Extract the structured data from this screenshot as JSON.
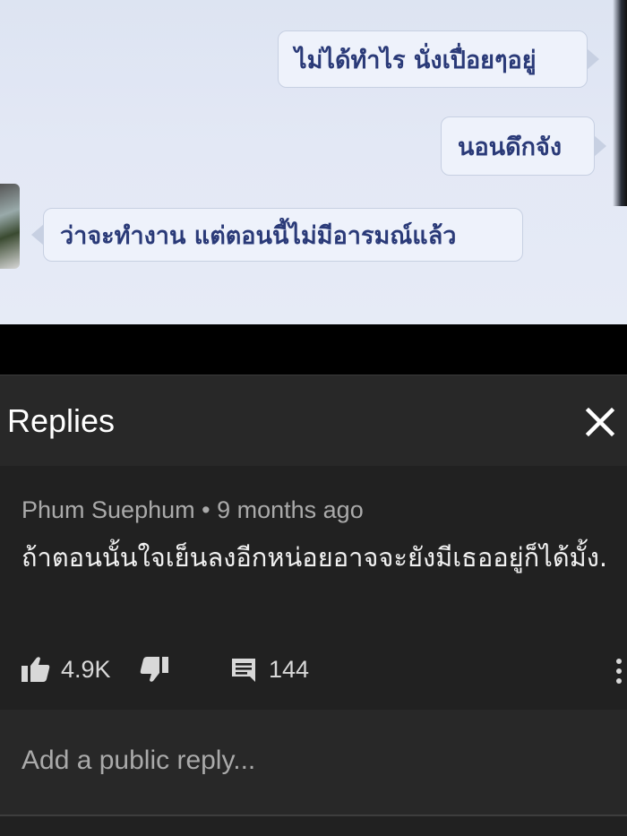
{
  "video": {
    "messages": [
      {
        "side": "right",
        "text": "ไม่ได้ทำไร นั่งเปื่อยๆอยู่"
      },
      {
        "side": "right",
        "text": "นอนดึกจัง"
      },
      {
        "side": "left",
        "text": "ว่าจะทำงาน แต่ตอนนี้ไม่มีอารมณ์แล้ว"
      }
    ]
  },
  "panel": {
    "title": "Replies",
    "close_icon": "close-icon"
  },
  "comment": {
    "author": "Phum Suephum",
    "separator": "•",
    "time": "9 months ago",
    "text": "ถ้าตอนนั้นใจเย็นลงอีกหน่อยอาจจะยังมีเธออยู่ก็ได้มั้ง.",
    "likes": "4.9K",
    "replies": "144",
    "icons": [
      "thumbs-up-icon",
      "thumbs-down-icon",
      "comment-icon",
      "more-vert-icon"
    ]
  },
  "reply_box": {
    "placeholder": "Add a public reply..."
  },
  "colors": {
    "background": "#212121",
    "header": "#282828",
    "text_primary": "#f1f1f1",
    "text_secondary": "#aaaaaa",
    "bubble_text": "#2a3a78"
  }
}
